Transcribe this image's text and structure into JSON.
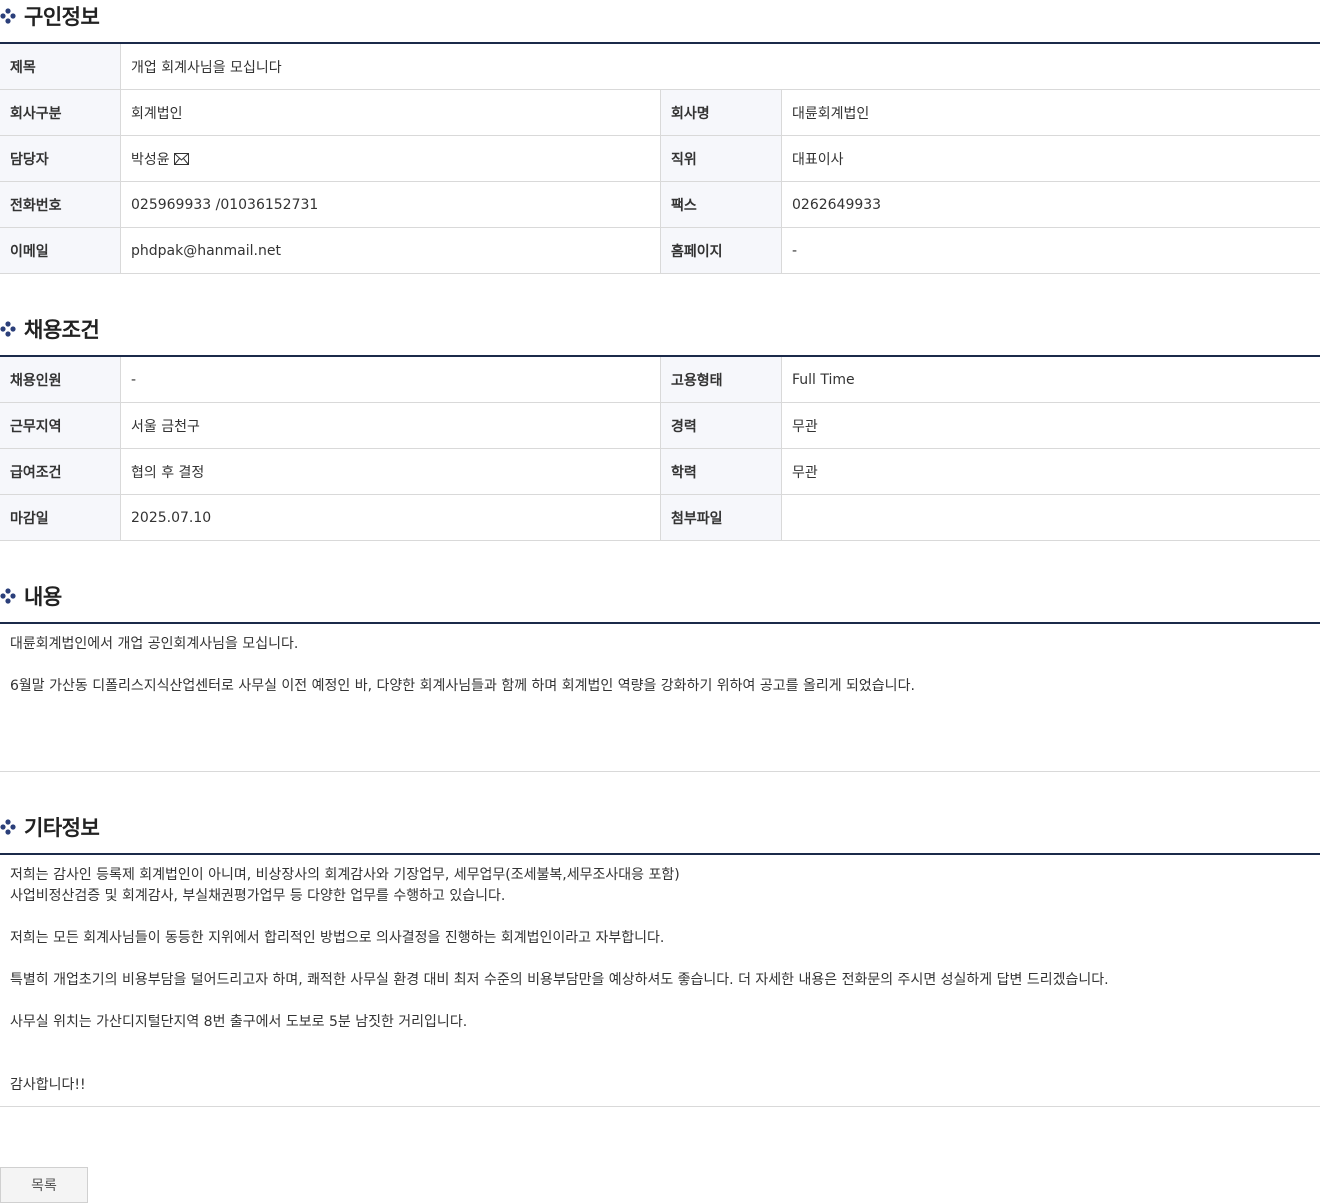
{
  "sections": {
    "recruiter_info": "구인정보",
    "hiring_conditions": "채용조건",
    "content": "내용",
    "other_info": "기타정보"
  },
  "recruiter": {
    "title_label": "제목",
    "title_value": "개업 회계사님을 모십니다",
    "company_type_label": "회사구분",
    "company_type_value": "회계법인",
    "company_name_label": "회사명",
    "company_name_value": "대륜회계법인",
    "contact_label": "담당자",
    "contact_value": "박성윤",
    "position_label": "직위",
    "position_value": "대표이사",
    "phone_label": "전화번호",
    "phone_value": "025969933 /01036152731",
    "fax_label": "팩스",
    "fax_value": "0262649933",
    "email_label": "이메일",
    "email_value": "phdpak@hanmail.net",
    "homepage_label": "홈페이지",
    "homepage_value": "-"
  },
  "conditions": {
    "headcount_label": "채용인원",
    "headcount_value": "-",
    "employment_type_label": "고용형태",
    "employment_type_value": "Full Time",
    "location_label": "근무지역",
    "location_value": "서울 금천구",
    "experience_label": "경력",
    "experience_value": "무관",
    "salary_label": "급여조건",
    "salary_value": "협의 후 결정",
    "education_label": "학력",
    "education_value": "무관",
    "deadline_label": "마감일",
    "deadline_value": "2025.07.10",
    "attachment_label": "첨부파일",
    "attachment_value": ""
  },
  "content": {
    "line1": "대륜회계법인에서 개업 공인회계사님을 모십니다.",
    "line2": "6월말 가산동 디폴리스지식산업센터로 사무실 이전 예정인 바, 다양한 회계사님들과 함께 하며 회계법인 역량을 강화하기 위하여 공고를 올리게 되었습니다."
  },
  "other": {
    "line1": "저희는 감사인 등록제 회계법인이 아니며, 비상장사의 회계감사와 기장업무, 세무업무(조세불복,세무조사대응 포함)",
    "line2": "사업비정산검증 및 회계감사, 부실채권평가업무 등 다양한 업무를 수행하고 있습니다.",
    "line3": "저희는 모든 회계사님들이 동등한 지위에서 합리적인 방법으로 의사결정을 진행하는 회계법인이라고 자부합니다.",
    "line4": "특별히 개업초기의 비용부담을 덜어드리고자 하며, 쾌적한 사무실 환경 대비 최저 수준의 비용부담만을 예상하셔도 좋습니다. 더 자세한 내용은 전화문의 주시면 성실하게 답변 드리겠습니다.",
    "line5": "사무실 위치는 가산디지털단지역 8번 출구에서 도보로 5분  남짓한 거리입니다.",
    "line6": "감사합니다!!"
  },
  "buttons": {
    "list_label": "목록"
  },
  "icons": {
    "section_marker": "dots-icon",
    "contact_mail": "mail-icon"
  },
  "colors": {
    "table_border_top": "#1b2a4a",
    "header_cell_bg": "#f6f7fb",
    "dot_icon": "#2b3f7a"
  }
}
